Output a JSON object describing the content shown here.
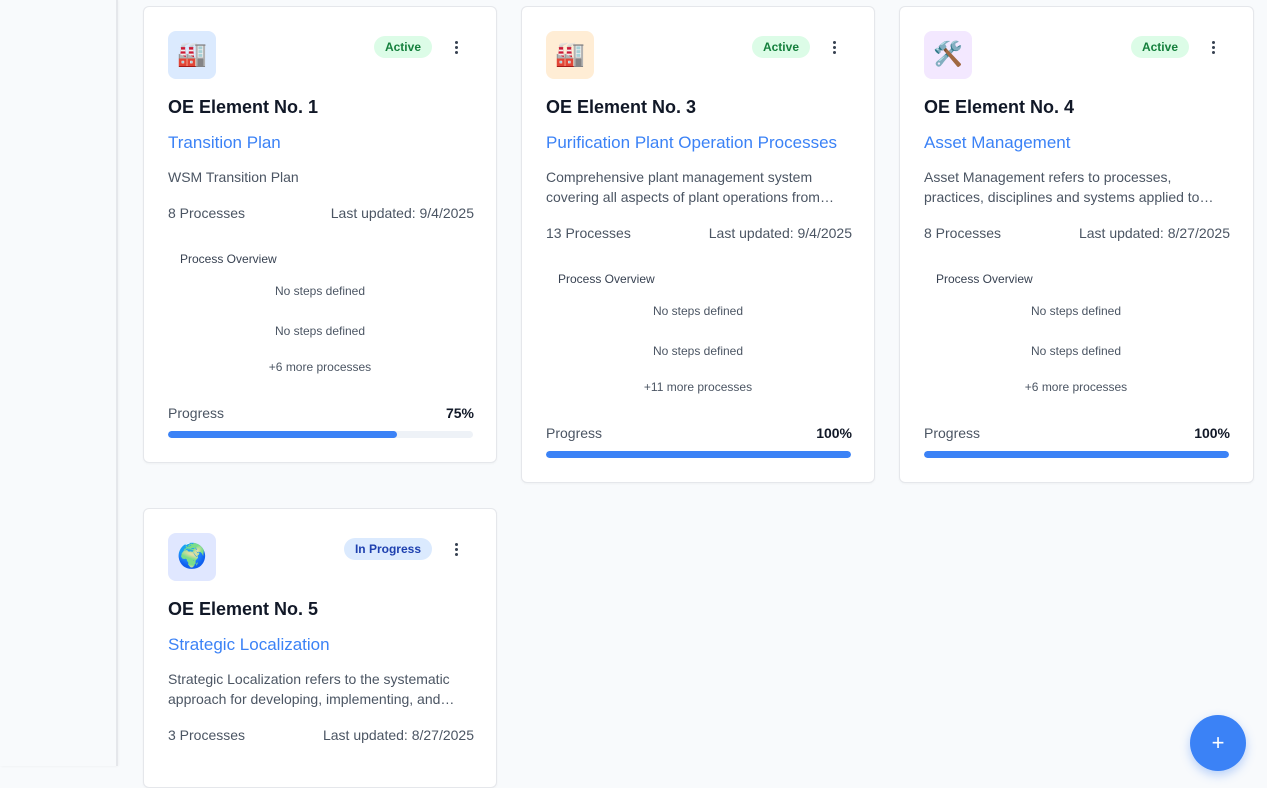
{
  "cards": [
    {
      "icon": "🏭",
      "icon_name": "factory-icon",
      "icon_bg": "#dbeafe",
      "status": "Active",
      "title": "OE Element No. 1",
      "subtitle": "Transition Plan",
      "description": "WSM Transition Plan",
      "processes": "8 Processes",
      "updated": "Last updated: 9/4/2025",
      "overview_title": "Process Overview",
      "steps": [
        "No steps defined",
        "No steps defined"
      ],
      "more": "+6 more processes",
      "progress_label": "Progress",
      "progress_text": "75%",
      "progress": 75
    },
    {
      "icon": "🏭",
      "icon_name": "factory-icon",
      "icon_bg": "#ffedd5",
      "status": "Active",
      "title": "OE Element No. 3",
      "subtitle": "Purification Plant Operation Processes",
      "description": "Comprehensive plant management system covering all aspects of plant operations from daily monitoring to maintenance",
      "processes": "13 Processes",
      "updated": "Last updated: 9/4/2025",
      "overview_title": "Process Overview",
      "steps": [
        "No steps defined",
        "No steps defined"
      ],
      "more": "+11 more processes",
      "progress_label": "Progress",
      "progress_text": "100%",
      "progress": 100
    },
    {
      "icon": "🛠️",
      "icon_name": "tools-icon",
      "icon_bg": "#f3e8ff",
      "status": "Active",
      "title": "OE Element No. 4",
      "subtitle": "Asset Management",
      "description": "Asset Management refers to processes, practices, disciplines and systems applied to physical assets",
      "processes": "8 Processes",
      "updated": "Last updated: 8/27/2025",
      "overview_title": "Process Overview",
      "steps": [
        "No steps defined",
        "No steps defined"
      ],
      "more": "+6 more processes",
      "progress_label": "Progress",
      "progress_text": "100%",
      "progress": 100
    },
    {
      "icon": "🌍",
      "icon_name": "globe-icon",
      "icon_bg": "#e0e7ff",
      "status": "In Progress",
      "title": "OE Element No. 5",
      "subtitle": "Strategic Localization",
      "description": "Strategic Localization refers to the systematic approach for developing, implementing, and monitoring localization",
      "processes": "3 Processes",
      "updated": "Last updated: 8/27/2025"
    }
  ],
  "fab": {
    "label": "+"
  }
}
